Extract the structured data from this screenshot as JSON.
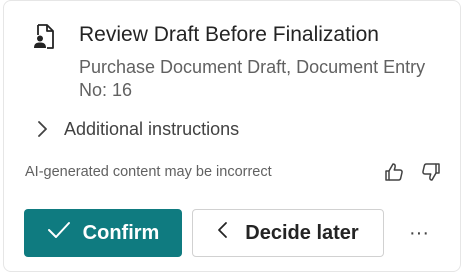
{
  "card": {
    "title": "Review Draft Before Finalization",
    "subtitle": "Purchase Document Draft, Document Entry No: 16",
    "instructions_label": "Additional instructions",
    "ai_note": "AI-generated content may be incorrect"
  },
  "actions": {
    "confirm_label": "Confirm",
    "decide_later_label": "Decide later",
    "more_label": "···"
  },
  "colors": {
    "primary": "#0f7b80",
    "text": "#242424",
    "secondary_text": "#616161",
    "border": "#d1d1d1"
  },
  "icons": {
    "document": "document-person-icon",
    "chevron": "chevron-right-icon",
    "thumbs_up": "thumbs-up-icon",
    "thumbs_down": "thumbs-down-icon",
    "checkmark": "checkmark-icon",
    "back": "chevron-left-icon",
    "more": "more-horizontal-icon"
  }
}
